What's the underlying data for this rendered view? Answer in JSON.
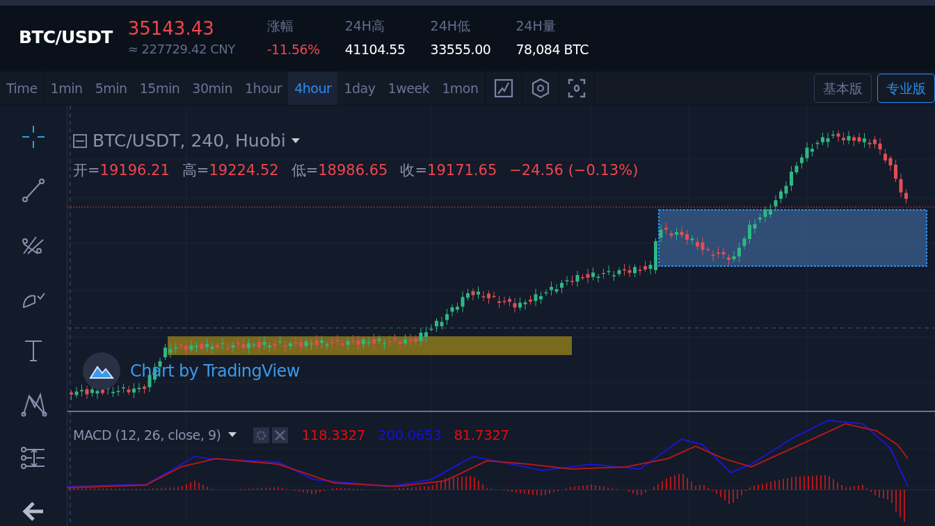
{
  "pair": "BTC/USDT",
  "price": "35143.43",
  "price_cny": "≈ 227729.42 CNY",
  "stats": [
    {
      "label": "涨幅",
      "value": "-11.56%",
      "kind": "down"
    },
    {
      "label": "24H高",
      "value": "41104.55",
      "kind": "plain"
    },
    {
      "label": "24H低",
      "value": "33555.00",
      "kind": "plain"
    },
    {
      "label": "24H量",
      "value": "78,084 BTC",
      "kind": "plain"
    }
  ],
  "intervals": [
    {
      "label": "Time",
      "selected": false
    },
    {
      "label": "1min",
      "selected": false
    },
    {
      "label": "5min",
      "selected": false
    },
    {
      "label": "15min",
      "selected": false
    },
    {
      "label": "30min",
      "selected": false
    },
    {
      "label": "1hour",
      "selected": false
    },
    {
      "label": "4hour",
      "selected": true
    },
    {
      "label": "1day",
      "selected": false
    },
    {
      "label": "1week",
      "selected": false
    },
    {
      "label": "1mon",
      "selected": false
    }
  ],
  "versions": [
    {
      "label": "基本版",
      "selected": false
    },
    {
      "label": "专业版",
      "selected": true
    }
  ],
  "chart": {
    "legend": "BTC/USDT, 240, Huobi",
    "ohlc": [
      {
        "label": "开=",
        "value": "19196.21"
      },
      {
        "label": "高=",
        "value": "19224.52"
      },
      {
        "label": "低=",
        "value": "18986.65"
      },
      {
        "label": "收=",
        "value": "19171.65"
      }
    ],
    "change": "−24.56 (−0.13%)",
    "branding": "Chart by TradingView"
  },
  "macd": {
    "label": "MACD (12, 26, close, 9)",
    "values": [
      {
        "text": "118.3327",
        "color": "#e00f0f"
      },
      {
        "text": "200.0653",
        "color": "#1212d8"
      },
      {
        "text": "81.7327",
        "color": "#e00f0f"
      }
    ]
  }
}
